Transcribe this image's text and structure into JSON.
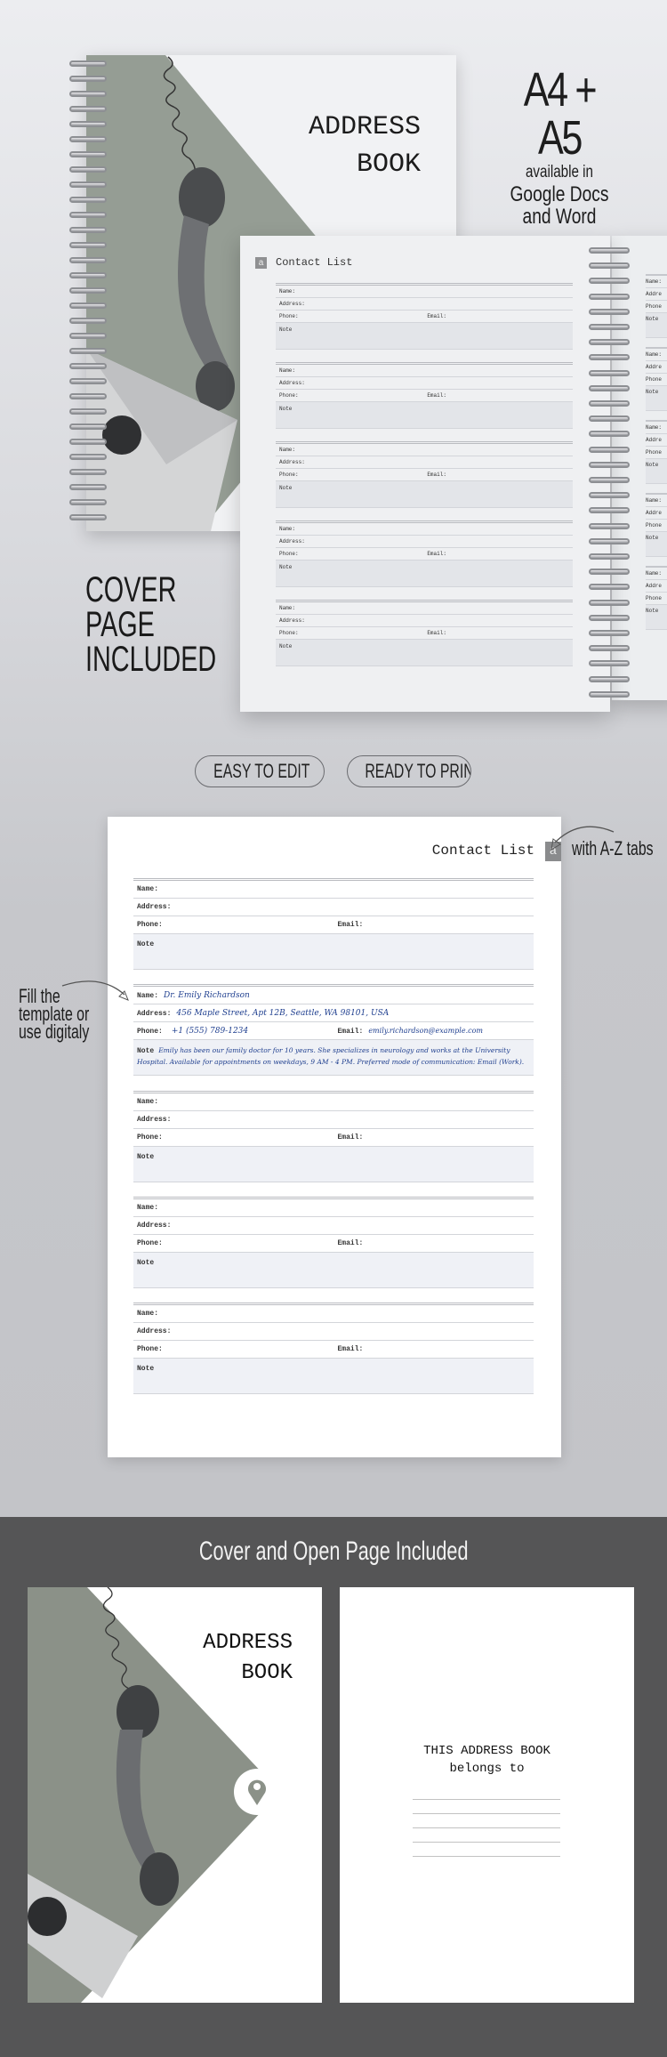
{
  "hero": {
    "cover_title_line1": "ADDRESS",
    "cover_title_line2": "BOOK",
    "formats": "A4 + A5",
    "available_in": "available in",
    "apps_line1": "Google Docs",
    "apps_line2": "and Word",
    "cover_note_line1": "COVER",
    "cover_note_line2": "PAGE",
    "cover_note_line3": "INCLUDED",
    "inner_page": {
      "tab_letter": "a",
      "title": "Contact List"
    },
    "side_page_labels": [
      "Name:",
      "Addre",
      "Phone",
      "Note"
    ]
  },
  "labels": {
    "name": "Name:",
    "address": "Address:",
    "phone": "Phone:",
    "email": "Email:",
    "note": "Note"
  },
  "badges": [
    "EASY TO EDIT",
    "READY TO PRINT"
  ],
  "sample_page": {
    "title": "Contact List",
    "tab_letter": "a",
    "tabs_callout": "with A-Z tabs",
    "fill_callout_line1": "Fill the",
    "fill_callout_line2": "template or",
    "fill_callout_line3": "use digitaly",
    "contacts": [
      {},
      {
        "name": "Dr. Emily Richardson",
        "address": "456 Maple Street, Apt 12B, Seattle, WA 98101, USA",
        "phone": "+1 (555) 789-1234",
        "email": "emily.richardson@example.com",
        "note": "Emily has been our family doctor for 10 years. She specializes in neurology and works at the University Hospital. Available for appointments on weekdays, 9 AM - 4 PM. Preferred mode of communication: Email (Work)."
      },
      {},
      {},
      {}
    ]
  },
  "bottom": {
    "heading": "Cover and Open Page Included",
    "cover_title_line1": "ADDRESS",
    "cover_title_line2": "BOOK",
    "open_page_line1": "THIS ADDRESS BOOK",
    "open_page_line2": "belongs to"
  },
  "colors": {
    "sage": "#959d94",
    "dark_band": "#555556",
    "ink": "#1f3f8f",
    "tab": "#8a8b8d"
  },
  "icons": [
    "spiral-binding",
    "telephone-handset",
    "sealed-envelope",
    "location-pin-icon",
    "curved-arrow-icon"
  ]
}
